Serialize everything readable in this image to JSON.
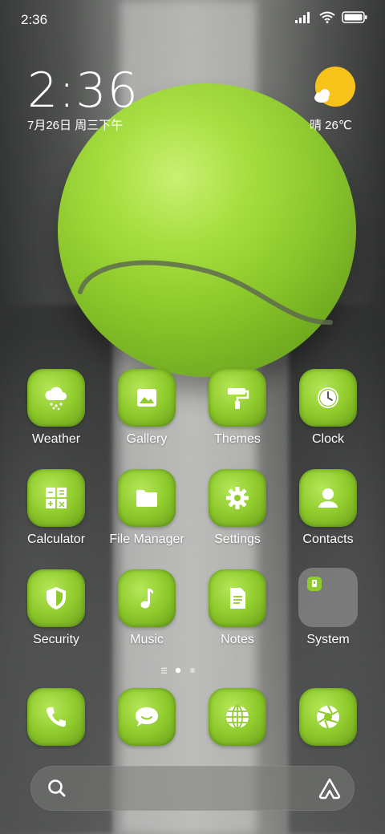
{
  "status_bar": {
    "time": "2:36"
  },
  "clock_widget": {
    "time": "2:36",
    "date": "7月26日 周三下午"
  },
  "weather_widget": {
    "condition_temp": "晴 26℃"
  },
  "apps": [
    {
      "label": "Weather",
      "icon": "cloud-rain-icon"
    },
    {
      "label": "Gallery",
      "icon": "image-icon"
    },
    {
      "label": "Themes",
      "icon": "paint-roller-icon"
    },
    {
      "label": "Clock",
      "icon": "clock-icon"
    },
    {
      "label": "Calculator",
      "icon": "calculator-icon"
    },
    {
      "label": "File Manager",
      "icon": "folder-icon"
    },
    {
      "label": "Settings",
      "icon": "gear-icon"
    },
    {
      "label": "Contacts",
      "icon": "person-icon"
    },
    {
      "label": "Security",
      "icon": "shield-icon"
    },
    {
      "label": "Music",
      "icon": "music-note-icon"
    },
    {
      "label": "Notes",
      "icon": "note-icon"
    },
    {
      "label": "System",
      "icon": "folder-group-icon"
    }
  ],
  "dock": [
    {
      "icon": "phone-icon"
    },
    {
      "icon": "message-icon"
    },
    {
      "icon": "globe-icon"
    },
    {
      "icon": "camera-shutter-icon"
    }
  ],
  "page_indicator": {
    "current_page": 1,
    "pages": 2
  },
  "colors": {
    "icon_green": "#8fcb2c",
    "glyph": "#ffffff"
  }
}
